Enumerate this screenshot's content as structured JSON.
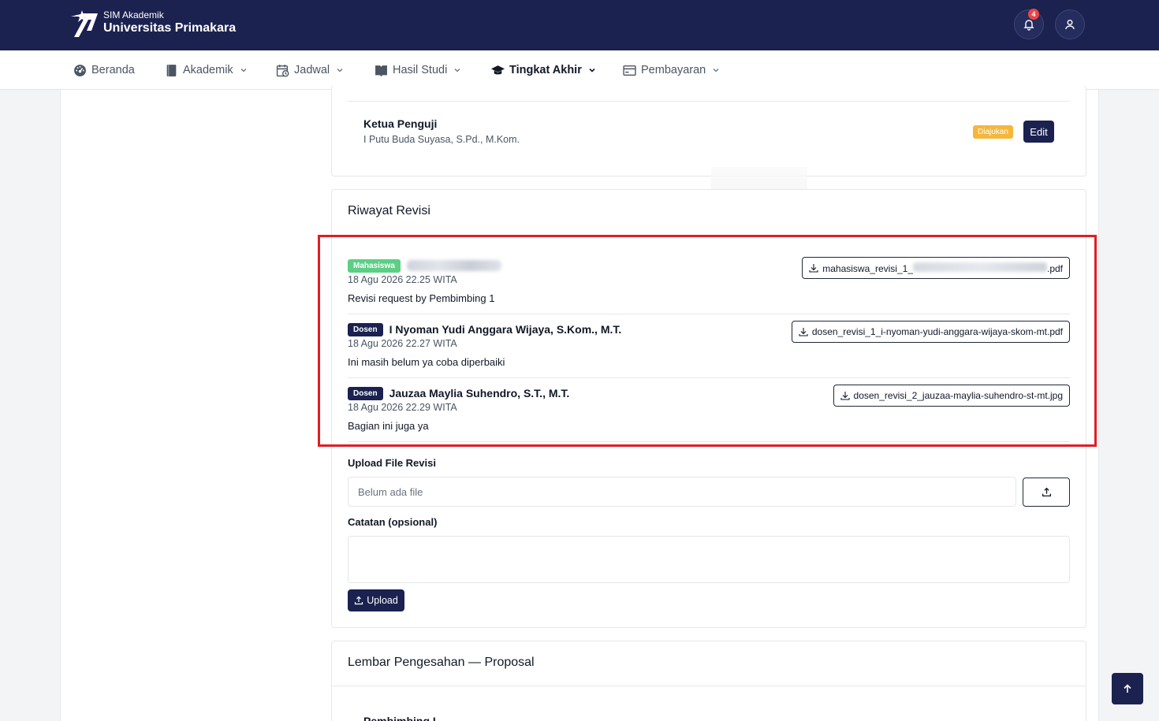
{
  "brand": {
    "subtitle": "SIM Akademik",
    "title": "Universitas Primakara"
  },
  "header": {
    "notification_count": "4"
  },
  "nav": {
    "items": [
      {
        "label": "Beranda",
        "icon": "dashboard-icon"
      },
      {
        "label": "Akademik",
        "icon": "book-icon"
      },
      {
        "label": "Jadwal",
        "icon": "calendar-clock-icon"
      },
      {
        "label": "Hasil Studi",
        "icon": "book-open-icon"
      },
      {
        "label": "Tingkat Akhir",
        "icon": "graduation-cap-icon"
      },
      {
        "label": "Pembayaran",
        "icon": "card-icon"
      }
    ]
  },
  "examiner": {
    "title": "Ketua Penguji",
    "name": "I Putu Buda Suyasa, S.Pd., M.Kom.",
    "status": "Diajukan",
    "edit_label": "Edit"
  },
  "revision_history": {
    "title": "Riwayat Revisi",
    "entries": [
      {
        "role": "Mahasiswa",
        "author": "",
        "date": "18 Agu 2026 22.25 WITA",
        "note": "Revisi request by Pembimbing 1",
        "file_prefix": "mahasiswa_revisi_1_",
        "file_suffix": ".pdf"
      },
      {
        "role": "Dosen",
        "author": "I Nyoman Yudi Anggara Wijaya, S.Kom., M.T.",
        "date": "18 Agu 2026 22.27 WITA",
        "note": "Ini masih belum ya coba diperbaiki",
        "file": "dosen_revisi_1_i-nyoman-yudi-anggara-wijaya-skom-mt.pdf"
      },
      {
        "role": "Dosen",
        "author": "Jauzaa Maylia Suhendro, S.T., M.T.",
        "date": "18 Agu 2026 22.29 WITA",
        "note": "Bagian ini juga ya",
        "file": "dosen_revisi_2_jauzaa-maylia-suhendro-st-mt.jpg"
      }
    ]
  },
  "upload_form": {
    "file_label": "Upload File Revisi",
    "file_placeholder": "Belum ada file",
    "note_label": "Catatan (opsional)",
    "note_value": "",
    "submit_label": "Upload"
  },
  "approval": {
    "title": "Lembar Pengesahan — Proposal",
    "first_item": "Pembimbing I"
  },
  "colors": {
    "primary": "#1b2250",
    "badge_mahasiswa": "#5ccf85",
    "badge_diajukan": "#f5b73b",
    "highlight": "#e11d24"
  }
}
